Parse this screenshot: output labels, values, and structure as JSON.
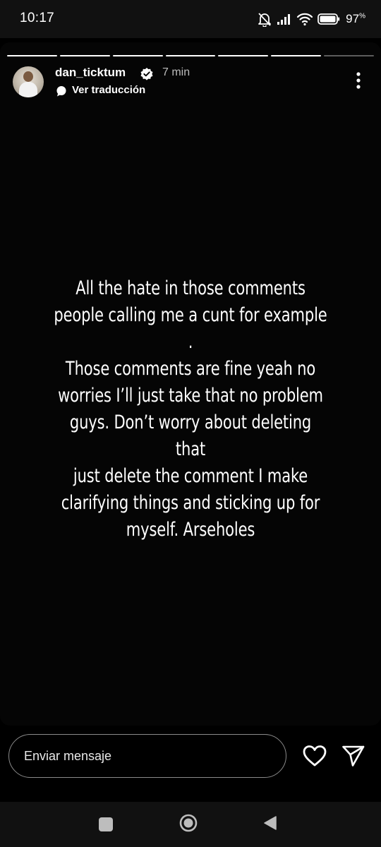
{
  "status_bar": {
    "time": "10:17",
    "battery_percent": "97",
    "battery_suffix": "%",
    "icons": [
      "bell-muted-icon",
      "signal-icon",
      "wifi-icon",
      "battery-icon"
    ]
  },
  "story": {
    "progress": {
      "segments_total": 7,
      "segments_viewed": 6
    },
    "author": {
      "username": "dan_ticktum",
      "verified": true,
      "time_ago": "7 min"
    },
    "translate_label": "Ver traducción",
    "text": "All the hate in those comments\npeople calling me a cunt for example .\nThose comments are fine yeah no\nworries I’ll just take that no problem\nguys. Don’t worry about deleting that\njust delete the comment I make\nclarifying things and sticking up for\nmyself. Arseholes"
  },
  "reply_bar": {
    "placeholder": "Enviar mensaje",
    "value": ""
  },
  "colors": {
    "background": "#000000",
    "system_bar": "#111111",
    "text": "#ffffff",
    "muted_text": "#bdbdbd",
    "input_border": "#8a8a8a"
  }
}
